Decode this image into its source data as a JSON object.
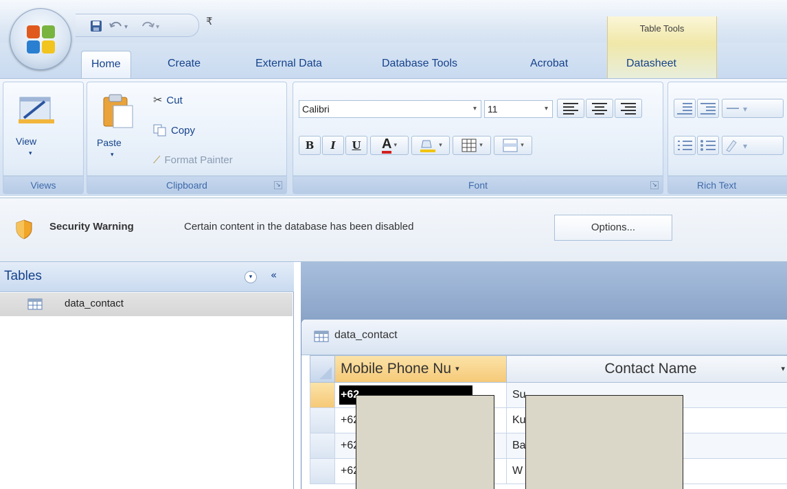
{
  "titlebar": {
    "quick_access": [
      "save-icon",
      "undo-icon",
      "redo-icon"
    ],
    "qat_customize": "₹",
    "contextual_group": "Table Tools"
  },
  "tabs": [
    {
      "label": "Home",
      "active": true
    },
    {
      "label": "Create"
    },
    {
      "label": "External Data"
    },
    {
      "label": "Database Tools"
    },
    {
      "label": "Acrobat"
    },
    {
      "label": "Datasheet",
      "contextual": true
    }
  ],
  "ribbon": {
    "views": {
      "label": "Views",
      "view_button": "View"
    },
    "clipboard": {
      "label": "Clipboard",
      "paste": "Paste",
      "cut": "Cut",
      "copy": "Copy",
      "format_painter": "Format Painter"
    },
    "font": {
      "label": "Font",
      "font_name": "Calibri",
      "font_size": "11",
      "bold": "B",
      "italic": "I",
      "underline": "U",
      "font_color_letter": "A"
    },
    "rich_text": {
      "label": "Rich Text"
    }
  },
  "security_bar": {
    "title": "Security Warning",
    "message": "Certain content in the database has been disabled",
    "options_button": "Options..."
  },
  "nav_pane": {
    "title": "Tables",
    "shutter": "«",
    "items": [
      {
        "label": "data_contact"
      }
    ]
  },
  "document": {
    "tab_title": "data_contact",
    "columns": [
      {
        "header": "Mobile Phone Nu"
      },
      {
        "header": "Contact Name"
      }
    ],
    "rows": [
      {
        "phone": "+62",
        "name": "Su"
      },
      {
        "phone": "+62",
        "name": "Ku"
      },
      {
        "phone": "+62",
        "name": "Ba"
      },
      {
        "phone": "+62",
        "name": "W"
      }
    ]
  },
  "colors": {
    "ribbon_text": "#15428b",
    "selected_header": "#f6c978",
    "redaction_fill": "#dad7c8"
  }
}
